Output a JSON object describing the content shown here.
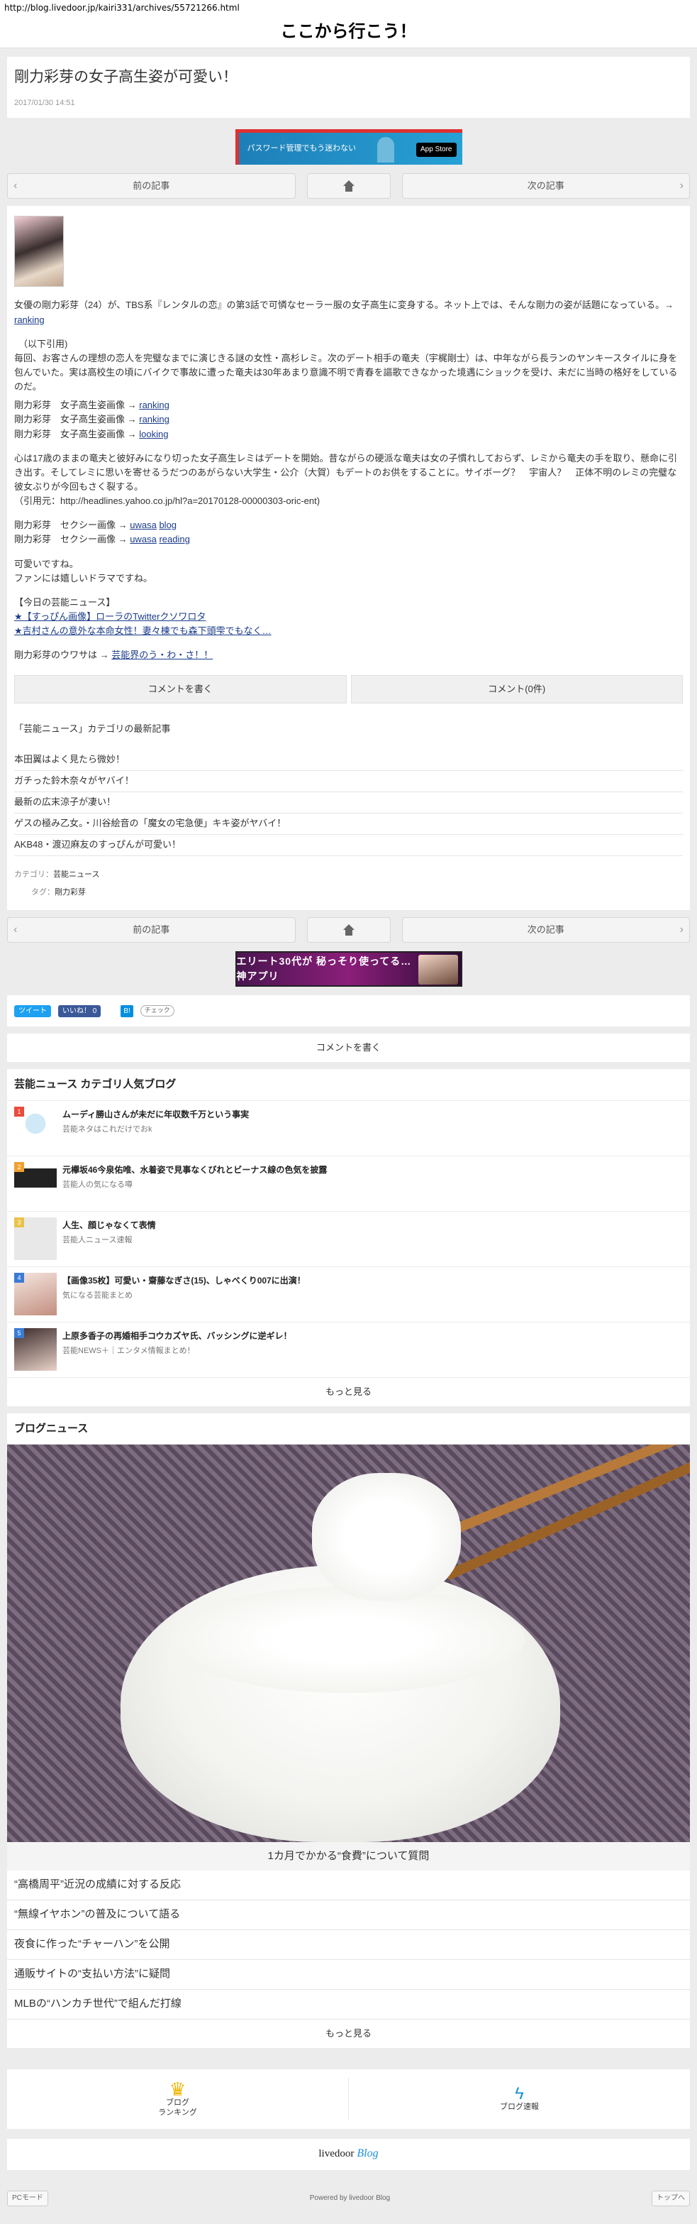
{
  "url": "http://blog.livedoor.jp/kairi331/archives/55721266.html",
  "site_title": "ここから行こう！",
  "post": {
    "title": "剛力彩芽の女子高生姿が可愛い！",
    "date": "2017/01/30 14:51"
  },
  "banner_top": {
    "text": "パスワード管理でもう迷わない",
    "store": "App Store"
  },
  "pager": {
    "prev": "前の記事",
    "next": "次の記事"
  },
  "article": {
    "lead": "女優の剛力彩芽（24）が、TBS系『レンタルの恋』の第3話で可憐なセーラー服の女子高生に変身する。ネット上では、そんな剛力の姿が話題になっている。→",
    "lead_link": "ranking",
    "quote_open": "（以下引用)",
    "quote_body": "毎回、お客さんの理想の恋人を完璧なまでに演じきる謎の女性・高杉レミ。次のデート相手の竜夫（宇梶剛士）は、中年ながら長ランのヤンキースタイルに身を包んでいた。実は高校生の頃にバイクで事故に遭った竜夫は30年あまり意識不明で青春を謳歌できなかった境遇にショックを受け、未だに当時の格好をしているのだ。",
    "image_lines": [
      {
        "prefix": "剛力彩芽　女子高生姿画像 →",
        "link": "ranking"
      },
      {
        "prefix": "剛力彩芽　女子高生姿画像 →",
        "link": "ranking"
      },
      {
        "prefix": "剛力彩芽　女子高生姿画像 →",
        "link": "looking"
      }
    ],
    "body2": "心は17歳のままの竜夫と彼好みになり切った女子高生レミはデートを開始。昔ながらの硬派な竜夫は女の子慣れしておらず、レミから竜夫の手を取り、懸命に引き出す。そしてレミに思いを寄せるうだつのあがらない大学生・公介（大賀）もデートのお供をすることに。サイボーグ？　宇宙人？　正体不明のレミの完璧な彼女ぶりが今回もさく裂する。",
    "cite": "（引用元：http://headlines.yahoo.co.jp/hl?a=20170128-00000303-oric-ent)",
    "sexy_lines": [
      {
        "prefix": "剛力彩芽　セクシー画像 →",
        "links": [
          "uwasa",
          "blog"
        ]
      },
      {
        "prefix": "剛力彩芽　セクシー画像 →",
        "links": [
          "uwasa",
          "reading"
        ]
      }
    ],
    "closing1": "可愛いですね。",
    "closing2": "ファンには嬉しいドラマですね。",
    "today_head": "【今日の芸能ニュース】",
    "today_items": [
      "★【すっぴん画像】ローラのTwitterクソワロタ",
      "★吉村さんの意外な本命女性！妻々棟でも森下頭雫でもなく…"
    ],
    "rumor_prefix": "剛力彩芽のウワサは →",
    "rumor_link": "芸能界のう・わ・さ！！"
  },
  "comments": {
    "write": "コメントを書く",
    "count": "コメント(0件)"
  },
  "latest": {
    "heading": "「芸能ニュース」カテゴリの最新記事",
    "items": [
      "本田翼はよく見たら微妙！",
      "ガチった鈴木奈々がヤバイ！",
      "最新の広末涼子が凄い！",
      "ゲスの極み乙女。・川谷絵音の「魔女の宅急便」キキ姿がヤバイ！",
      "AKB48・渡辺麻友のすっぴんが可愛い！"
    ]
  },
  "meta": {
    "category_label": "カテゴリ：",
    "category_value": "芸能ニュース",
    "tag_label": "タグ：",
    "tag_value": "剛力彩芽"
  },
  "banner_game": {
    "text": "エリート30代が 秘っそり使ってる… 神アプリ"
  },
  "share": {
    "tweet": "ツイート",
    "like": "いいね！ 0",
    "check": "チェック"
  },
  "write_comment": "コメントを書く",
  "popular": {
    "heading": "芸能ニュース カテゴリ人気ブログ",
    "items": [
      {
        "rank": "1",
        "title": "ムーディ勝山さんが未だに年収数千万という事実",
        "sub": "芸能ネタはこれだけでおk",
        "color": "#e94b3c"
      },
      {
        "rank": "2",
        "title": "元欅坂46今泉佑唯、水着姿で見事なくびれとビーナス線の色気を披露",
        "sub": "芸能人の気になる噂",
        "color": "#f0a030"
      },
      {
        "rank": "3",
        "title": "人生、顔じゃなくて表情",
        "sub": "芸能人ニュース速報",
        "color": "#e8c24a"
      },
      {
        "rank": "4",
        "title": "【画像35枚】可愛い・齋藤なぎさ(15)、しゃべくり007に出演！",
        "sub": "気になる芸能まとめ",
        "color": "#3a7bd5"
      },
      {
        "rank": "5",
        "title": "上原多香子の再婚相手コウカズヤ氏、バッシングに逆ギレ！",
        "sub": "芸能NEWS＋｜エンタメ情報まとめ！",
        "color": "#3a7bd5"
      }
    ],
    "more": "もっと見る"
  },
  "blog_news": {
    "heading": "ブログニュース",
    "caption": "1カ月でかかる“食費”について質問",
    "items": [
      "“高橋周平”近況の成績に対する反応",
      "“無線イヤホン”の普及について語る",
      "夜食に作った“チャーハン”を公開",
      "通販サイトの“支払い方法”に疑問",
      "MLBの“ハンカチ世代”で組んだ打線"
    ],
    "more": "もっと見る"
  },
  "footer_nav": {
    "ranking": [
      "ブログ",
      "ランキング"
    ],
    "bulletin": "ブログ速報"
  },
  "logo": {
    "a": "livedoor",
    "b": "Blog"
  },
  "bottom": {
    "pc_mode": "PCモード",
    "powered": "Powered by livedoor Blog",
    "top": "トップへ"
  }
}
